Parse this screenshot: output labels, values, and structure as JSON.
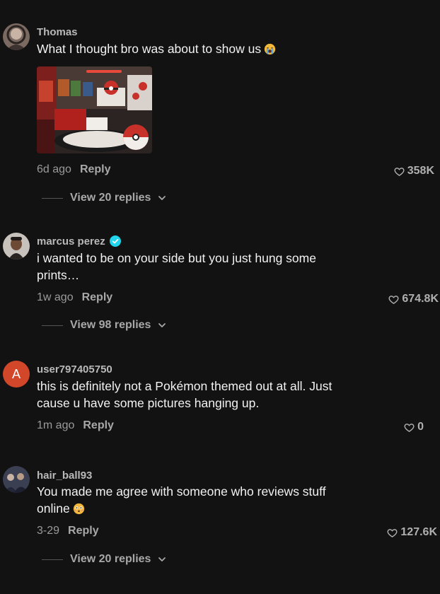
{
  "comments": [
    {
      "username": "Thomas",
      "text": "What I thought bro was about to show us",
      "emoji": "loudly-crying-face-emoji",
      "has_image": true,
      "time": "6d ago",
      "reply_label": "Reply",
      "likes": "358K",
      "view_replies": "View 20 replies"
    },
    {
      "username": "marcus perez",
      "verified": true,
      "text": "i wanted to be on your side but you just hung some prints…",
      "time": "1w ago",
      "reply_label": "Reply",
      "likes": "674.8K",
      "view_replies": "View 98 replies"
    },
    {
      "username": "user797405750",
      "avatar_letter": "A",
      "text": "this is definitely not a Pokémon themed out at all. Just cause u have some pictures hanging up.",
      "time": "1m ago",
      "reply_label": "Reply",
      "likes": "0"
    },
    {
      "username": "hair_ball93",
      "text": "You made me agree with someone who reviews stuff online",
      "emoji": "flushed-face-emoji",
      "time": "3-29",
      "reply_label": "Reply",
      "likes": "127.6K",
      "view_replies": "View 20 replies"
    }
  ],
  "colors": {
    "background": "#121212",
    "username": "#b9b9b9",
    "text": "#f2f2f2",
    "meta": "#9a9a9a",
    "avatar_letter_bg": "#d2472a",
    "verified": "#20d5ec"
  }
}
